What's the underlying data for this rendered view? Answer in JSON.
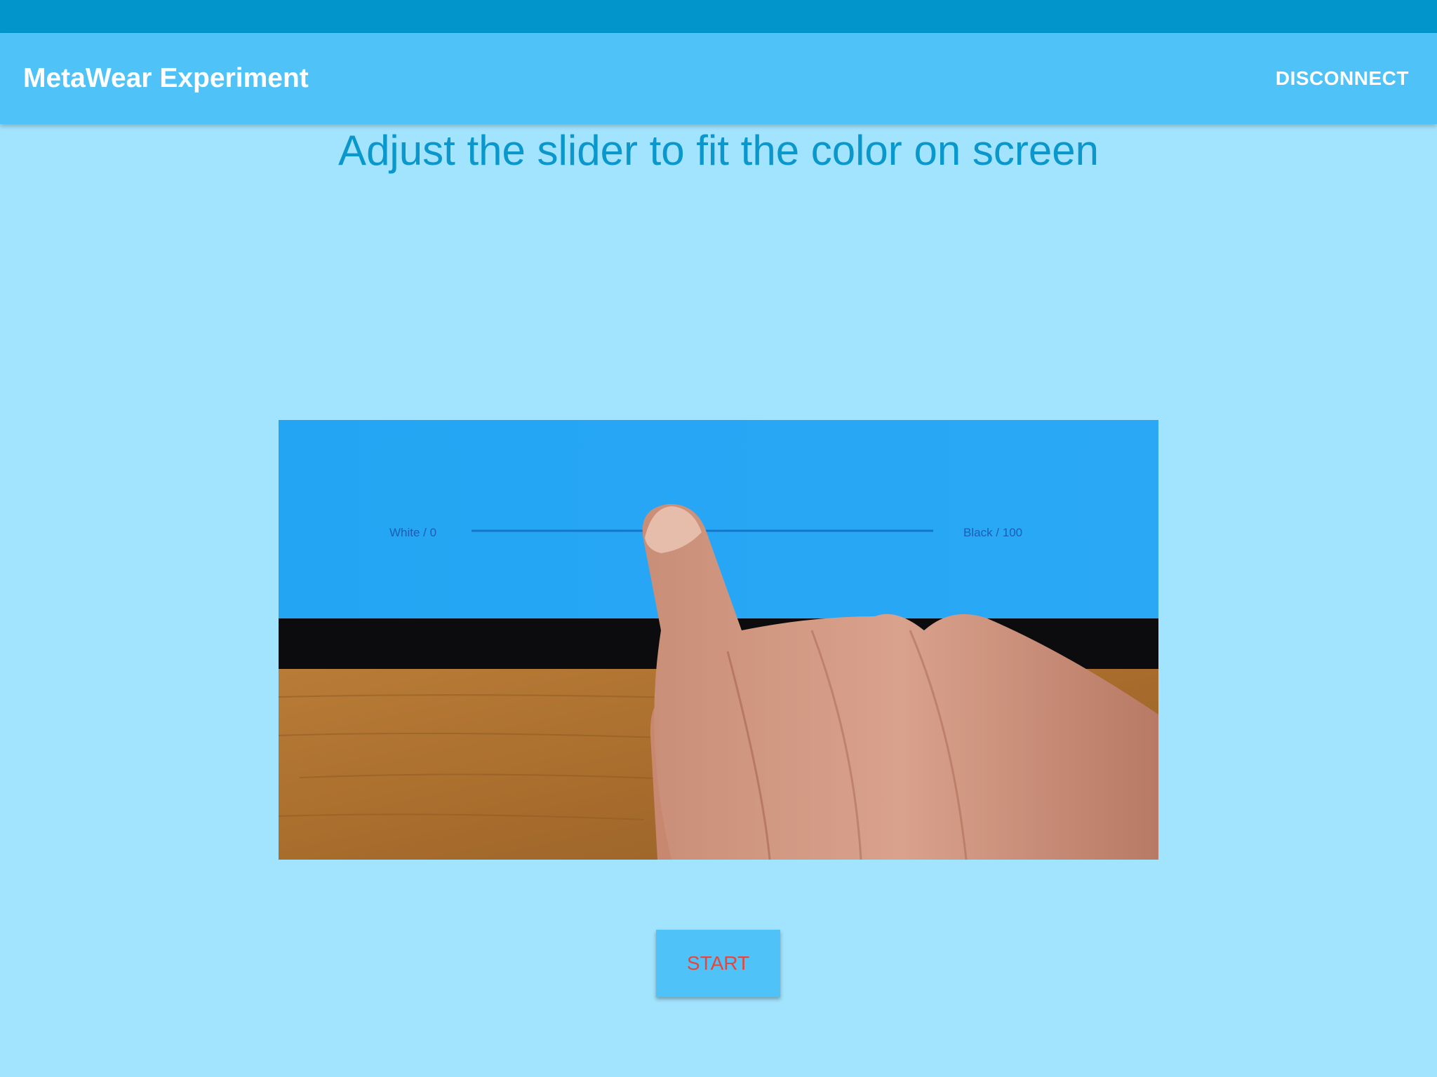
{
  "app_bar": {
    "title": "MetaWear Experiment",
    "disconnect_label": "DISCONNECT"
  },
  "main": {
    "instruction": "Adjust the slider to fit the color on screen",
    "demo_image": {
      "slider_left_label": "White / 0",
      "slider_right_label": "Black / 100"
    },
    "start_label": "START"
  },
  "colors": {
    "status_bar": "#0295cb",
    "app_bar": "#4fc2f8",
    "background": "#a2e3fd",
    "instruction_text": "#0a97cc",
    "start_text": "#e8453c"
  }
}
